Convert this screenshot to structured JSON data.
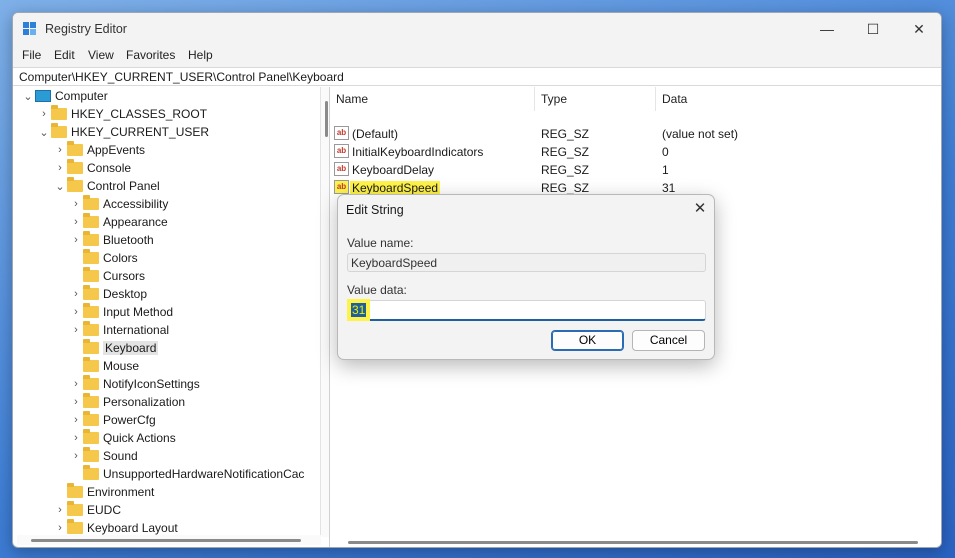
{
  "window": {
    "title": "Registry Editor",
    "controls": {
      "minimize": "—",
      "maximize": "☐",
      "close": "✕"
    }
  },
  "menu": [
    "File",
    "Edit",
    "View",
    "Favorites",
    "Help"
  ],
  "address": "Computer\\HKEY_CURRENT_USER\\Control Panel\\Keyboard",
  "tree": {
    "root": "Computer",
    "hkcr": "HKEY_CLASSES_ROOT",
    "hkcu": "HKEY_CURRENT_USER",
    "hkcu_children": [
      "AppEvents",
      "Console",
      "Control Panel"
    ],
    "control_panel_children": [
      "Accessibility",
      "Appearance",
      "Bluetooth",
      "Colors",
      "Cursors",
      "Desktop",
      "Input Method",
      "International",
      "Keyboard",
      "Mouse",
      "NotifyIconSettings",
      "Personalization",
      "PowerCfg",
      "Quick Actions",
      "Sound",
      "UnsupportedHardwareNotificationCac"
    ],
    "after": [
      "Environment",
      "EUDC",
      "Keyboard Layout"
    ],
    "selected": "Keyboard"
  },
  "list": {
    "columns": [
      "Name",
      "Type",
      "Data"
    ],
    "rows": [
      {
        "name": "(Default)",
        "type": "REG_SZ",
        "data": "(value not set)"
      },
      {
        "name": "InitialKeyboardIndicators",
        "type": "REG_SZ",
        "data": "0"
      },
      {
        "name": "KeyboardDelay",
        "type": "REG_SZ",
        "data": "1"
      },
      {
        "name": "KeyboardSpeed",
        "type": "REG_SZ",
        "data": "31"
      }
    ],
    "icon_text": "ab"
  },
  "dialog": {
    "title": "Edit String",
    "value_name_label": "Value name:",
    "value_name": "KeyboardSpeed",
    "value_data_label": "Value data:",
    "value_data": "31",
    "ok": "OK",
    "cancel": "Cancel"
  },
  "colors": {
    "highlight": "#fff34a",
    "selection": "#1f5f9e",
    "folder": "#f5c84c"
  }
}
